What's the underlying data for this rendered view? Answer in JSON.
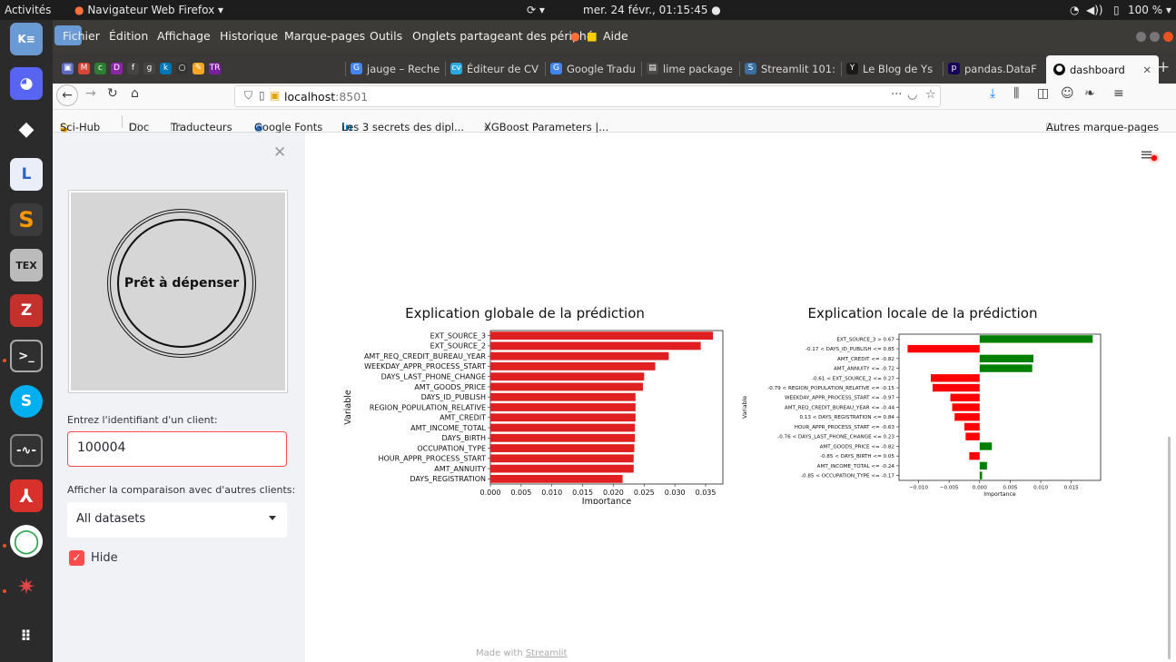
{
  "topbar": {
    "activities": "Activités",
    "app": "Navigateur Web Firefox ▾",
    "datetime": "mer. 24 févr., 01:15:45 ●",
    "battery": "100 %"
  },
  "menu": [
    "Fichier",
    "Édition",
    "Affichage",
    "Historique",
    "Marque-pages",
    "Outils",
    "Onglets partageant des périphé",
    "Aide"
  ],
  "tabs": [
    {
      "label": "jauge – Reche",
      "icon": "G",
      "color": "#4285f4"
    },
    {
      "label": "Éditeur de CV",
      "icon": "cv",
      "color": "#2aa9e0"
    },
    {
      "label": "Google Tradu",
      "icon": "G",
      "color": "#4285f4"
    },
    {
      "label": "lime package",
      "icon": "▤",
      "color": "#4a4a4a"
    },
    {
      "label": "Streamlit 101:",
      "icon": "S",
      "color": "#3b6ea5"
    },
    {
      "label": "Le Blog de Ys",
      "icon": "Y",
      "color": "#1a1a1a"
    },
    {
      "label": "pandas.DataF",
      "icon": "p",
      "color": "#150458"
    },
    {
      "label": "dashboard",
      "icon": "●",
      "color": "#111"
    }
  ],
  "nav": {
    "url_host": "localhost",
    "url_port": ":8501"
  },
  "bookmarks": [
    "Sci-Hub",
    "Doc",
    "Traducteurs",
    "Google Fonts",
    "Les 3 secrets des dipl...",
    "XGBoost Parameters |...",
    "Autres marque-pages"
  ],
  "sidebar": {
    "logo_text": "Prêt à dépenser",
    "id_label": "Entrez l'identifiant d'un client:",
    "id_value": "100004",
    "compare_label": "Afficher la comparaison avec d'autres clients:",
    "compare_value": "All datasets",
    "hide_label": "Hide"
  },
  "footer": {
    "prefix": "Made with ",
    "link": "Streamlit"
  },
  "chart_data": [
    {
      "type": "bar",
      "orientation": "horizontal",
      "title": "Explication globale de la prédiction",
      "xlabel": "Importance",
      "ylabel": "Variable",
      "color": "#e02020",
      "categories": [
        "EXT_SOURCE_3",
        "EXT_SOURCE_2",
        "AMT_REQ_CREDIT_BUREAU_YEAR",
        "WEEKDAY_APPR_PROCESS_START",
        "DAYS_LAST_PHONE_CHANGE",
        "AMT_GOODS_PRICE",
        "DAYS_ID_PUBLISH",
        "REGION_POPULATION_RELATIVE",
        "AMT_CREDIT",
        "AMT_INCOME_TOTAL",
        "DAYS_BIRTH",
        "OCCUPATION_TYPE",
        "HOUR_APPR_PROCESS_START",
        "AMT_ANNUITY",
        "DAYS_REGISTRATION"
      ],
      "values": [
        0.0362,
        0.0342,
        0.029,
        0.0268,
        0.025,
        0.0248,
        0.0236,
        0.0236,
        0.0236,
        0.0235,
        0.0235,
        0.0234,
        0.0233,
        0.0233,
        0.0215
      ],
      "xlim": [
        0,
        0.0378
      ],
      "xticks": [
        "0.000",
        "0.005",
        "0.010",
        "0.015",
        "0.020",
        "0.025",
        "0.030",
        "0.035"
      ]
    },
    {
      "type": "bar",
      "orientation": "horizontal",
      "title": "Explication locale de la prédiction",
      "xlabel": "Importance",
      "ylabel": "Variable",
      "positive_color": "#008000",
      "negative_color": "#ff0000",
      "categories": [
        "EXT_SOURCE_3 > 0.67",
        "-0.17 < DAYS_ID_PUBLISH <= 0.85",
        "AMT_CREDIT <= -0.82",
        "AMT_ANNUITY <= -0.72",
        "-0.61 < EXT_SOURCE_2 <= 0.27",
        "-0.79 < REGION_POPULATION_RELATIVE <= -0.15",
        "WEEKDAY_APPR_PROCESS_START <= -0.97",
        "AMT_REQ_CREDIT_BUREAU_YEAR <= -0.44",
        "0.13 < DAYS_REGISTRATION <= 0.84",
        "HOUR_APPR_PROCESS_START <= -0.63",
        "-0.76 < DAYS_LAST_PHONE_CHANGE <= 0.23",
        "AMT_GOODS_PRICE <= -0.82",
        "-0.85 < DAYS_BIRTH <= 0.05",
        "AMT_INCOME_TOTAL <= -0.24",
        "-0.85 < OCCUPATION_TYPE <= -0.17"
      ],
      "values": [
        0.0185,
        -0.0118,
        0.0088,
        0.0086,
        -0.008,
        -0.0077,
        -0.0048,
        -0.0045,
        -0.0041,
        -0.0025,
        -0.0023,
        0.002,
        -0.0017,
        0.0012,
        0.0004
      ],
      "xlim": [
        -0.0132,
        0.0198
      ],
      "xticks": [
        "−0.010",
        "−0.005",
        "0.000",
        "0.005",
        "0.010",
        "0.015"
      ],
      "xtick_values": [
        -0.01,
        -0.005,
        0.0,
        0.005,
        0.01,
        0.015
      ]
    }
  ]
}
